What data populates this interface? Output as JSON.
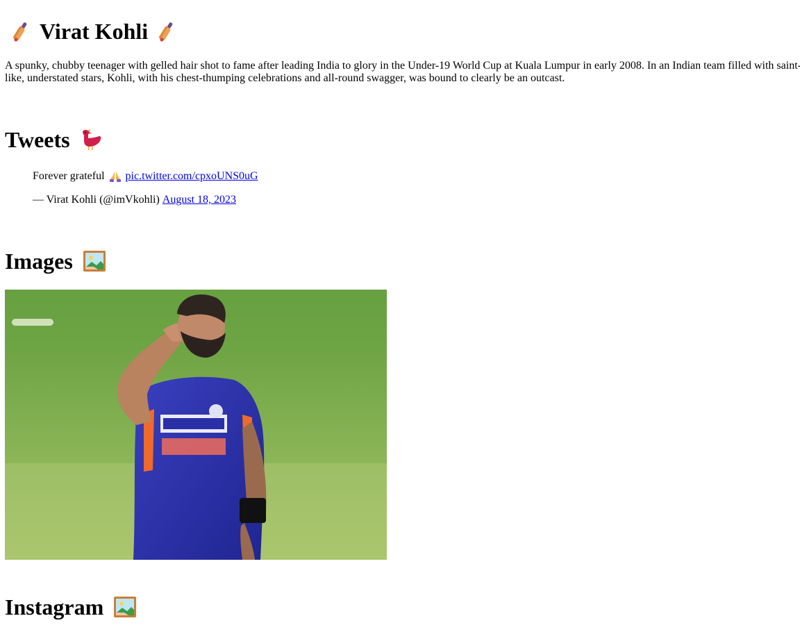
{
  "profile": {
    "name": "Virat Kohli",
    "bio": "A spunky, chubby teenager with gelled hair shot to fame after leading India to glory in the Under-19 World Cup at Kuala Lumpur in early 2008. In an Indian team filled with saint-like, understated stars, Kohli, with his chest-thumping celebrations and all-round swagger, was bound to clearly be an outcast."
  },
  "sections": {
    "tweets": "Tweets",
    "images": "Images",
    "instagram": "Instagram"
  },
  "tweet": {
    "text": "Forever grateful",
    "link": "pic.twitter.com/cpxoUNS0uG",
    "author": "— Virat Kohli (@imVkohli)",
    "date": "August 18, 2023"
  },
  "icons": {
    "title": "cricket-bat-icon",
    "tweets": "bird-icon",
    "images": "framed-picture-icon",
    "instagram": "framed-picture-icon",
    "tweet_emoji": "folded-hands-icon"
  },
  "colors": {
    "link": "#0000ee",
    "bird": "#d21f4a",
    "bat": "#f0a050"
  }
}
